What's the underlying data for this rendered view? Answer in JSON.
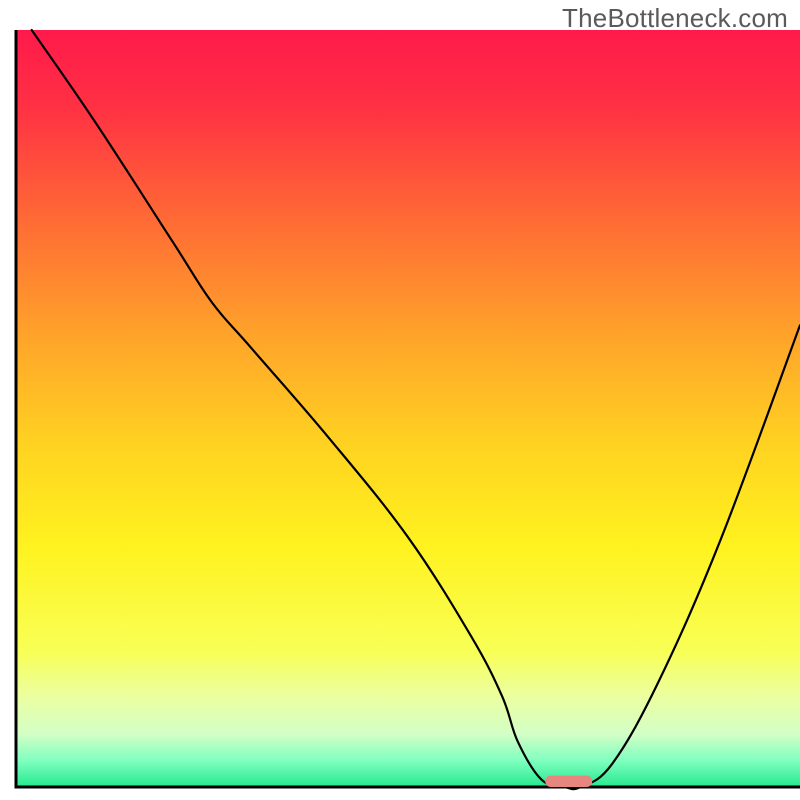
{
  "watermark": "TheBottleneck.com",
  "chart_data": {
    "type": "line",
    "title": "",
    "xlabel": "",
    "ylabel": "",
    "xlim": [
      0,
      100
    ],
    "ylim": [
      0,
      100
    ],
    "grid": false,
    "legend": false,
    "series": [
      {
        "name": "bottleneck-curve",
        "x": [
          2,
          10,
          20,
          25,
          30,
          40,
          50,
          58,
          62,
          64,
          67,
          70,
          72,
          76,
          82,
          90,
          100
        ],
        "y": [
          100,
          88,
          72,
          64,
          58,
          46,
          33,
          20,
          12,
          6,
          1,
          0,
          0,
          3,
          14,
          33,
          61
        ]
      }
    ],
    "marker": {
      "name": "optimal-marker",
      "x_center": 70.5,
      "y": 0,
      "width": 6,
      "height": 1.5,
      "color": "#e7857f"
    },
    "gradient_stops": [
      {
        "offset": 0.0,
        "color": "#ff1a4b"
      },
      {
        "offset": 0.1,
        "color": "#ff3044"
      },
      {
        "offset": 0.25,
        "color": "#ff6a35"
      },
      {
        "offset": 0.4,
        "color": "#ffa22a"
      },
      {
        "offset": 0.55,
        "color": "#ffd321"
      },
      {
        "offset": 0.68,
        "color": "#fff21f"
      },
      {
        "offset": 0.82,
        "color": "#f8ff55"
      },
      {
        "offset": 0.88,
        "color": "#ecffa0"
      },
      {
        "offset": 0.93,
        "color": "#d3ffc6"
      },
      {
        "offset": 0.965,
        "color": "#7fffc0"
      },
      {
        "offset": 1.0,
        "color": "#24e98d"
      }
    ],
    "axis_color": "#000000",
    "line_color": "#000000",
    "line_width": 2.2
  }
}
